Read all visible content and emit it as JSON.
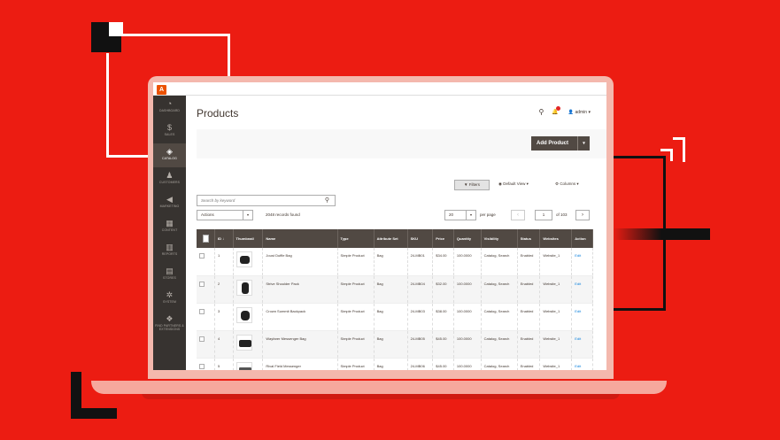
{
  "colors": {
    "background": "#ec1c12",
    "sidebar": "#373330",
    "header_row": "#514943",
    "link": "#007bdb",
    "logo": "#eb5202"
  },
  "app": {
    "logo_letter": "A"
  },
  "sidebar": {
    "items": [
      {
        "icon": "dashboard-icon",
        "glyph": "◔",
        "label": "DASHBOARD"
      },
      {
        "icon": "sales-icon",
        "glyph": "$",
        "label": "SALES"
      },
      {
        "icon": "catalog-icon",
        "glyph": "◈",
        "label": "CATALOG",
        "active": true
      },
      {
        "icon": "customers-icon",
        "glyph": "♟",
        "label": "CUSTOMERS"
      },
      {
        "icon": "marketing-icon",
        "glyph": "◀",
        "label": "MARKETING"
      },
      {
        "icon": "content-icon",
        "glyph": "▦",
        "label": "CONTENT"
      },
      {
        "icon": "reports-icon",
        "glyph": "▥",
        "label": "REPORTS"
      },
      {
        "icon": "stores-icon",
        "glyph": "▤",
        "label": "STORES"
      },
      {
        "icon": "system-icon",
        "glyph": "✲",
        "label": "SYSTEM"
      },
      {
        "icon": "partners-icon",
        "glyph": "❖",
        "label": "FIND PARTNERS & EXTENSIONS"
      }
    ]
  },
  "header": {
    "title": "Products",
    "user": "admin ▾",
    "search_glyph": "⚲",
    "bell_glyph": "🔔",
    "user_glyph": "👤"
  },
  "toolbar": {
    "add_label": "Add Product",
    "add_caret": "▾",
    "filters_label": "Filters",
    "filters_glyph": "▼",
    "view_label": "Default View ▾",
    "view_glyph": "◉",
    "columns_label": "Columns ▾",
    "columns_glyph": "⚙"
  },
  "search": {
    "placeholder": "Search by keyword",
    "icon_glyph": "⚲"
  },
  "actions": {
    "label": "Actions",
    "caret": "▾",
    "records": "2048 records found"
  },
  "pager": {
    "per_page": "20",
    "caret": "▾",
    "per_page_label": "per page",
    "prev": "‹",
    "page": "1",
    "of": "of 103",
    "next": "›"
  },
  "table": {
    "columns": [
      "ID ↓",
      "Thumbnail",
      "Name",
      "Type",
      "Attribute Set",
      "SKU",
      "Price",
      "Quantity",
      "Visibility",
      "Status",
      "Websites",
      "Action"
    ],
    "rows": [
      {
        "id": "1",
        "name": "Joust Duffle Bag",
        "type": "Simple Product",
        "attr": "Bag",
        "sku": "24-MB01",
        "price": "$34.00",
        "qty": "100.0000",
        "vis": "Catalog, Search",
        "status": "Enabled",
        "web": "Website_1",
        "action": "Edit"
      },
      {
        "id": "2",
        "name": "Strive Shoulder Pack",
        "type": "Simple Product",
        "attr": "Bag",
        "sku": "24-MB04",
        "price": "$32.00",
        "qty": "100.0000",
        "vis": "Catalog, Search",
        "status": "Enabled",
        "web": "Website_1",
        "action": "Edit"
      },
      {
        "id": "3",
        "name": "Crown Summit Backpack",
        "type": "Simple Product",
        "attr": "Bag",
        "sku": "24-MB03",
        "price": "$38.00",
        "qty": "100.0000",
        "vis": "Catalog, Search",
        "status": "Enabled",
        "web": "Website_1",
        "action": "Edit"
      },
      {
        "id": "4",
        "name": "Wayfarer Messenger Bag",
        "type": "Simple Product",
        "attr": "Bag",
        "sku": "24-MB05",
        "price": "$45.00",
        "qty": "100.0000",
        "vis": "Catalog, Search",
        "status": "Enabled",
        "web": "Website_1",
        "action": "Edit"
      },
      {
        "id": "5",
        "name": "Rival Field Messenger",
        "type": "Simple Product",
        "attr": "Bag",
        "sku": "24-MB06",
        "price": "$45.00",
        "qty": "100.0000",
        "vis": "Catalog, Search",
        "status": "Enabled",
        "web": "Website_1",
        "action": "Edit"
      }
    ]
  }
}
